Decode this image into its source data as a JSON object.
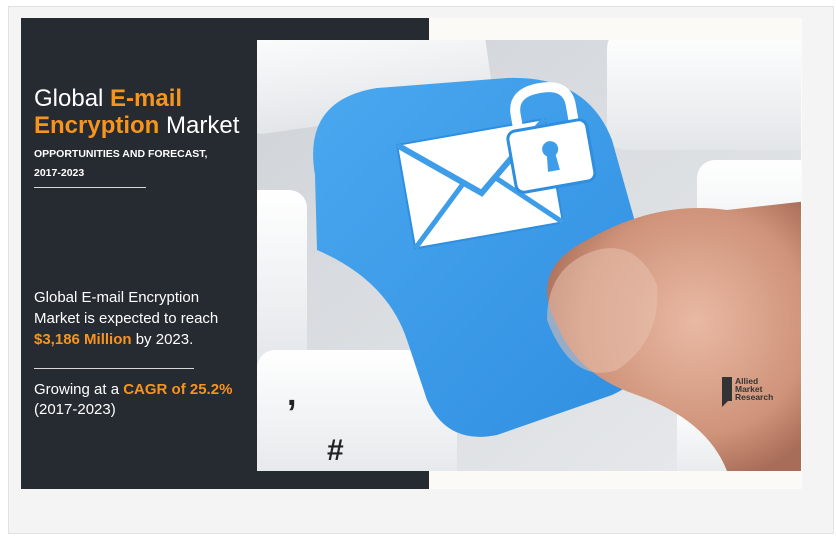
{
  "banner": {
    "title": {
      "part1": "Global ",
      "part2": "E-mail",
      "part3": "Encryption",
      "part4": " Market"
    },
    "subtitle": {
      "line1": "OPPORTUNITIES AND FORECAST,",
      "line2": "2017-2023"
    },
    "description": {
      "line1": "Global E-mail Encryption",
      "line2": "Market is expected to reach",
      "value": "$3,186 Million",
      "suffix": " by 2023."
    },
    "growth": {
      "prefix": "Growing at a ",
      "cagr": "CAGR of 25.2%",
      "period": "(2017-2023)"
    },
    "logo": {
      "line1": "Allied",
      "line2": "Market",
      "line3": "Research"
    },
    "colors": {
      "accent": "#f7941d",
      "panel": "#262a31",
      "key_blue": "#3d9de8"
    },
    "photo": {
      "icons": [
        "envelope-icon",
        "padlock-icon"
      ]
    }
  }
}
